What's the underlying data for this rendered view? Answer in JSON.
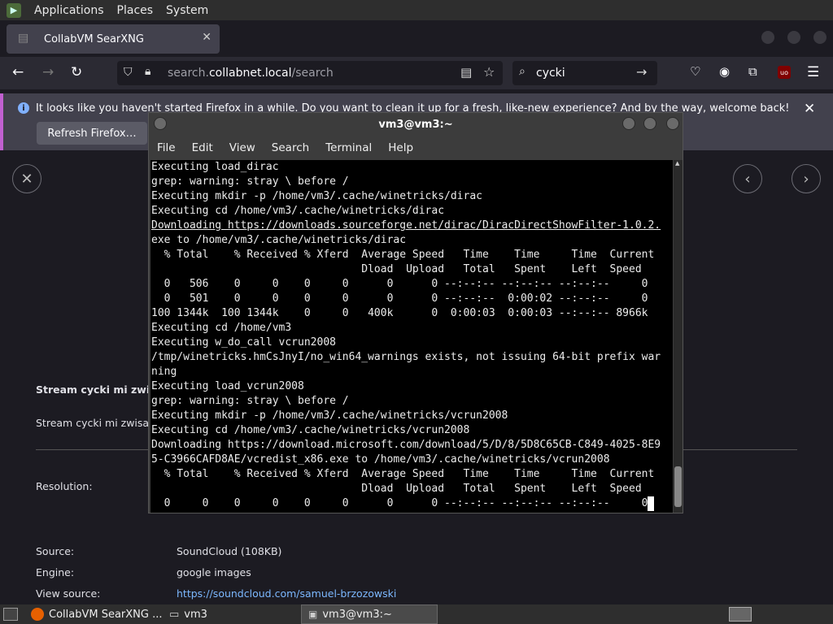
{
  "top_panel": {
    "applications": "Applications",
    "places": "Places",
    "system": "System"
  },
  "browser": {
    "tab_title": "CollabVM SearXNG",
    "url_host": "search.",
    "url_domain": "collabnet.local",
    "url_path": "/search",
    "search_value": "cycki",
    "notification_text": "It looks like you haven't started Firefox in a while. Do you want to clean it up for a fresh, like-new experience? And by the way, welcome back!",
    "refresh_label": "Refresh Firefox…"
  },
  "page": {
    "result_title": "Stream cycki mi zwisają",
    "result_desc": "Stream cycki mi zwisają",
    "resolution_label": "Resolution:",
    "source_label": "Source:",
    "source_value": "SoundCloud (108KB)",
    "engine_label": "Engine:",
    "engine_value": "google images",
    "view_source_label": "View source:",
    "view_source_url": "https://soundcloud.com/samuel-brzozowski"
  },
  "terminal": {
    "title": "vm3@vm3:~",
    "menu": [
      "File",
      "Edit",
      "View",
      "Search",
      "Terminal",
      "Help"
    ],
    "lines": [
      "Executing load_dirac",
      "grep: warning: stray \\ before /",
      "Executing mkdir -p /home/vm3/.cache/winetricks/dirac",
      "Executing cd /home/vm3/.cache/winetricks/dirac",
      "Downloading https://downloads.sourceforge.net/dirac/DiracDirectShowFilter-1.0.2.",
      "exe to /home/vm3/.cache/winetricks/dirac",
      "  % Total    % Received % Xferd  Average Speed   Time    Time     Time  Current",
      "                                 Dload  Upload   Total   Spent    Left  Speed",
      "  0   506    0     0    0     0      0      0 --:--:-- --:--:-- --:--:--     0",
      "  0   501    0     0    0     0      0      0 --:--:--  0:00:02 --:--:--     0",
      "100 1344k  100 1344k    0     0   400k      0  0:00:03  0:00:03 --:--:-- 8966k",
      "Executing cd /home/vm3",
      "Executing w_do_call vcrun2008",
      "/tmp/winetricks.hmCsJnyI/no_win64_warnings exists, not issuing 64-bit prefix war",
      "ning",
      "Executing load_vcrun2008",
      "grep: warning: stray \\ before /",
      "Executing mkdir -p /home/vm3/.cache/winetricks/vcrun2008",
      "Executing cd /home/vm3/.cache/winetricks/vcrun2008",
      "Downloading https://download.microsoft.com/download/5/D/8/5D8C65CB-C849-4025-8E9",
      "5-C3966CAFD8AE/vcredist_x86.exe to /home/vm3/.cache/winetricks/vcrun2008",
      "  % Total    % Received % Xferd  Average Speed   Time    Time     Time  Current",
      "                                 Dload  Upload   Total   Spent    Left  Speed",
      "  0     0    0     0    0     0      0      0 --:--:-- --:--:-- --:--:--     0"
    ]
  },
  "taskbar": {
    "firefox_task": "CollabVM SearXNG ...",
    "folder_task": "vm3",
    "terminal_task": "vm3@vm3:~"
  }
}
